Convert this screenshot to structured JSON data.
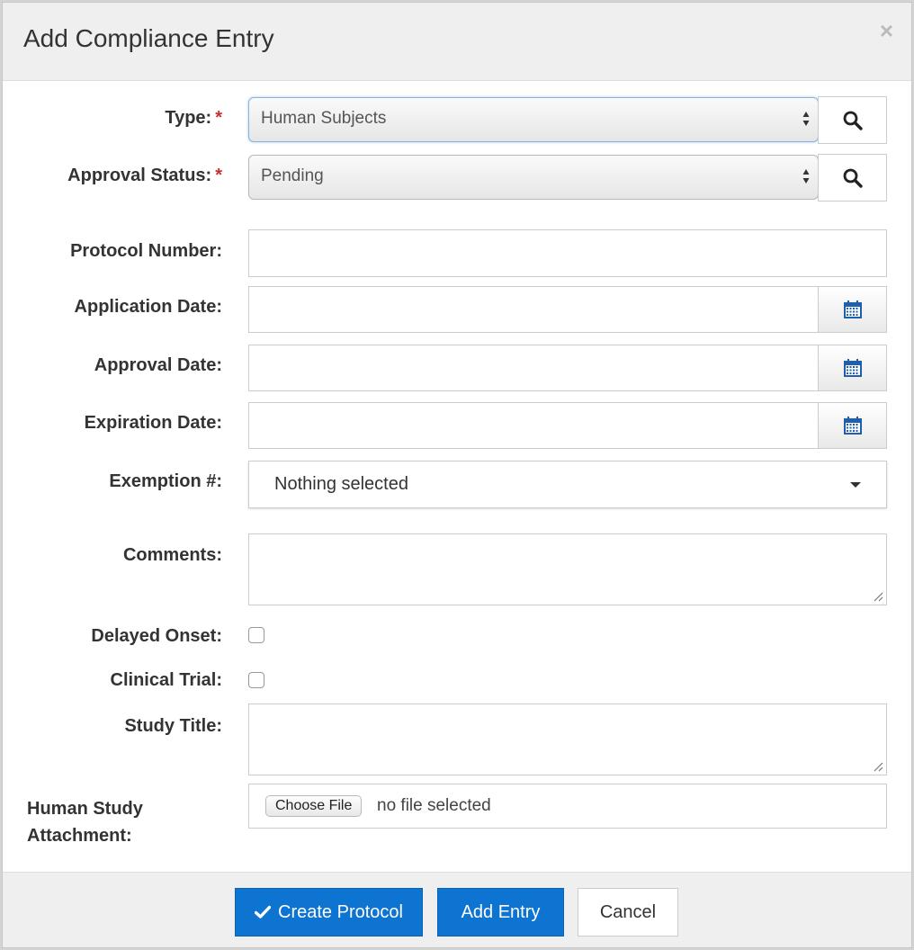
{
  "dialog": {
    "title": "Add Compliance Entry",
    "close_symbol": "×"
  },
  "form": {
    "type_label": "Type:",
    "type_value": "Human Subjects",
    "approval_status_label": "Approval Status:",
    "approval_status_value": "Pending",
    "required_marker": "*",
    "protocol_number_label": "Protocol Number:",
    "protocol_number_value": "",
    "application_date_label": "Application Date:",
    "approval_date_label": "Approval Date:",
    "expiration_date_label": "Expiration Date:",
    "exemption_label": "Exemption #:",
    "exemption_value": "Nothing selected",
    "comments_label": "Comments:",
    "delayed_onset_label": "Delayed Onset:",
    "delayed_onset_checked": false,
    "clinical_trial_label": "Clinical Trial:",
    "clinical_trial_checked": false,
    "study_title_label": "Study Title:",
    "attachment_label_line1": "Human Study",
    "attachment_label_line2": "Attachment:",
    "choose_file_label": "Choose File",
    "file_status": "no file selected"
  },
  "footer": {
    "create_protocol_label": "Create Protocol",
    "add_entry_label": "Add Entry",
    "cancel_label": "Cancel"
  },
  "colors": {
    "primary": "#0e74d1",
    "required": "#c9302c",
    "calendar_icon": "#1f5fae"
  },
  "icons": [
    "close-icon",
    "search-icon",
    "calendar-icon",
    "caret-down-icon",
    "check-icon",
    "select-arrows-icon",
    "resize-grip-icon"
  ]
}
